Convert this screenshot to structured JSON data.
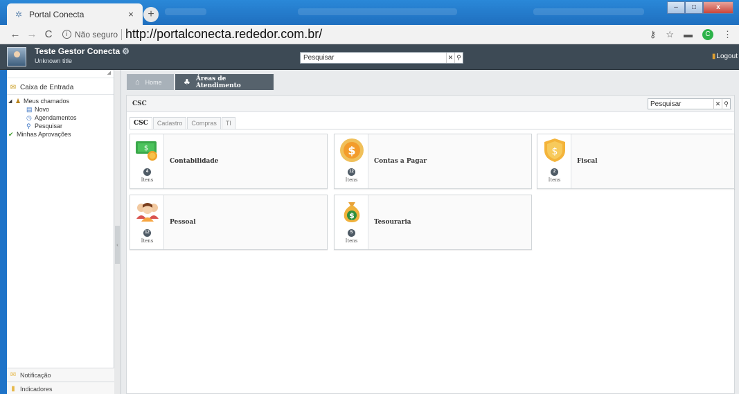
{
  "browser": {
    "tab_title": "Portal Conecta",
    "tab_close": "×",
    "new_tab": "+",
    "security_label": "Não seguro",
    "url": "http://portalconecta.rededor.com.br/",
    "profile_initial": "C"
  },
  "header": {
    "user_name": "Teste Gestor Conecta",
    "user_title": "Unknown title",
    "search_placeholder": "Pesquisar",
    "logout_label": "Logout"
  },
  "sidebar": {
    "inbox_label": "Caixa de Entrada",
    "tree": {
      "root_label": "Meus chamados",
      "children": [
        "Novo",
        "Agendamentos",
        "Pesquisar"
      ],
      "approvals_label": "Minhas Aprovações"
    },
    "bottom": [
      "Notificação",
      "Indicadores"
    ]
  },
  "breadcrumb": {
    "home": "Home",
    "current": "Áreas de Atendimento"
  },
  "panel": {
    "title": "CSC",
    "search_placeholder": "Pesquisar",
    "tabs": [
      "CSC",
      "Cadastro",
      "Compras",
      "TI"
    ],
    "active_tab": "CSC"
  },
  "cards": [
    {
      "name": "Contabilidade",
      "count": "4",
      "unit": "Itens",
      "icon": "money-icon"
    },
    {
      "name": "Contas a Pagar",
      "count": "12",
      "unit": "Itens",
      "icon": "dollar-coin-icon"
    },
    {
      "name": "Fiscal",
      "count": "2",
      "unit": "Itens",
      "icon": "shield-dollar-icon"
    },
    {
      "name": "Pessoal",
      "count": "12",
      "unit": "Itens",
      "icon": "people-icon"
    },
    {
      "name": "Tesouraria",
      "count": "5",
      "unit": "Itens",
      "icon": "money-bag-icon"
    }
  ],
  "colors": {
    "header": "#3d4a55",
    "breadcrumb_active": "#56626c",
    "badge": "#4f5b66"
  }
}
